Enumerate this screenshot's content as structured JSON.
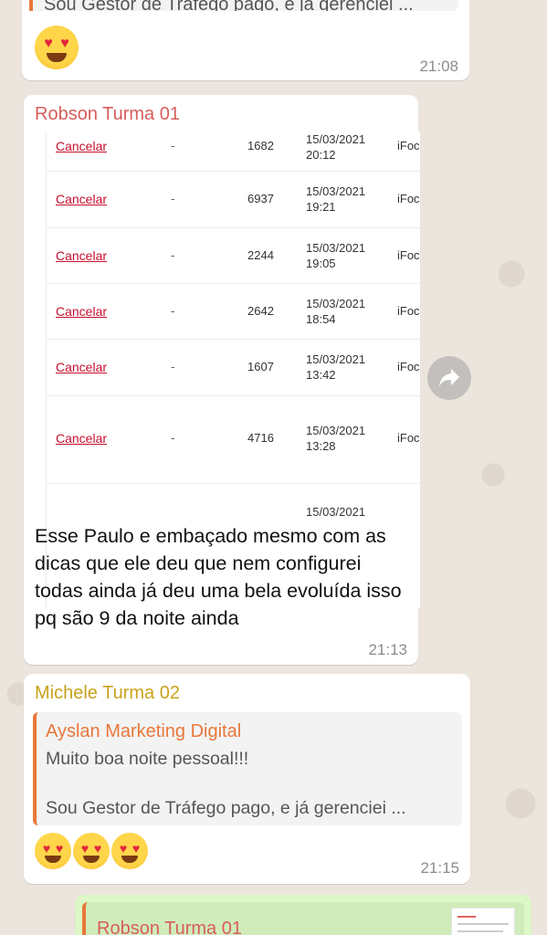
{
  "top_message": {
    "quote_text": "Sou Gestor de Tráfego pago, e já gerenciei ...",
    "emoji": "heart-eyes-emoji",
    "time": "21:08"
  },
  "image_message": {
    "sender": "Robson Turma 01",
    "sender_color": "#d85c5c",
    "screenshot_rows": [
      {
        "action": "Cancelar",
        "dash": "-",
        "number": "1682",
        "date": "15/03/2021",
        "time": "20:12",
        "store": "iFoc"
      },
      {
        "action": "Cancelar",
        "dash": "-",
        "number": "6937",
        "date": "15/03/2021",
        "time": "19:21",
        "store": "iFoc"
      },
      {
        "action": "Cancelar",
        "dash": "-",
        "number": "2244",
        "date": "15/03/2021",
        "time": "19:05",
        "store": "iFoc"
      },
      {
        "action": "Cancelar",
        "dash": "-",
        "number": "2642",
        "date": "15/03/2021",
        "time": "18:54",
        "store": "iFoc"
      },
      {
        "action": "Cancelar",
        "dash": "-",
        "number": "1607",
        "date": "15/03/2021",
        "time": "13:42",
        "store": "iFoc"
      },
      {
        "action": "Cancelar",
        "dash": "-",
        "number": "4716",
        "date": "15/03/2021",
        "time": "13:28",
        "store": "iFoc"
      },
      {
        "action": "",
        "dash": "",
        "number": "",
        "date": "15/03/2021",
        "time": "",
        "store": ""
      }
    ],
    "caption": "Esse Paulo e embaçado mesmo com as dicas que ele deu que nem configurei todas ainda já deu uma bela evoluída isso pq são 9 da noite ainda",
    "time": "21:13"
  },
  "forward_button": {
    "icon": "forward-arrow-icon"
  },
  "reply_message": {
    "sender": "Michele Turma 02",
    "sender_color": "#c9a21c",
    "quoted_sender": "Ayslan Marketing Digital",
    "quoted_line1": "Muito boa noite pessoal!!!",
    "quoted_line2": "Sou Gestor de Tráfego pago, e já gerenciei ...",
    "emojis": [
      "heart-eyes-emoji",
      "heart-eyes-emoji",
      "heart-eyes-emoji"
    ],
    "time": "21:15"
  },
  "outgoing_message": {
    "quoted_sender": "Robson Turma 01"
  },
  "colors": {
    "chat_background": "#ece5dd",
    "incoming_bubble": "#ffffff",
    "outgoing_bubble": "#dcf8c6",
    "quote_bar": "#e8773a",
    "cancel_link": "#c8102e"
  }
}
